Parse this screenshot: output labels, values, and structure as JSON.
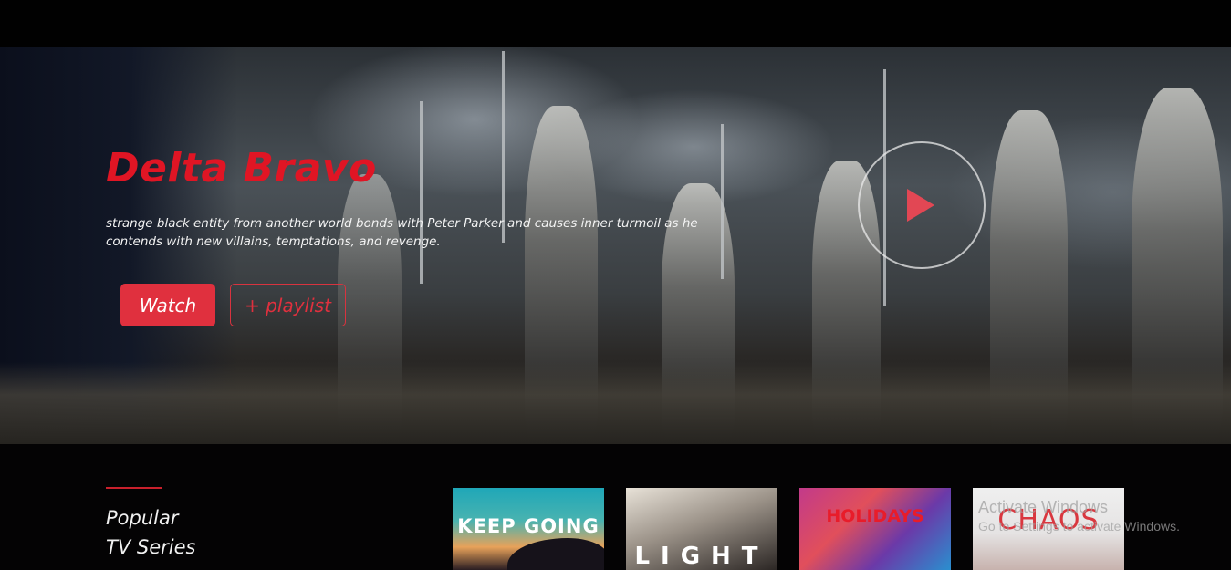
{
  "hero": {
    "title": "Delta Bravo",
    "description": "strange black entity from another world bonds with Peter Parker and causes inner turmoil as he contends with new villains, temptations, and revenge.",
    "watch_label": "Watch",
    "playlist_label": "+ playlist",
    "play_icon": "play-icon"
  },
  "section": {
    "title_line1": "Popular",
    "title_line2": "TV Series"
  },
  "thumbnails": [
    {
      "title": "KEEP GOING"
    },
    {
      "title": "LIGHT"
    },
    {
      "title": "HOLIDAYS"
    },
    {
      "title": "CHAOS"
    }
  ],
  "watermark": {
    "line1": "Activate Windows",
    "line2": "Go to Settings to activate Windows."
  },
  "colors": {
    "accent": "#e0303e",
    "title_red": "#e01524",
    "background": "#040304"
  }
}
